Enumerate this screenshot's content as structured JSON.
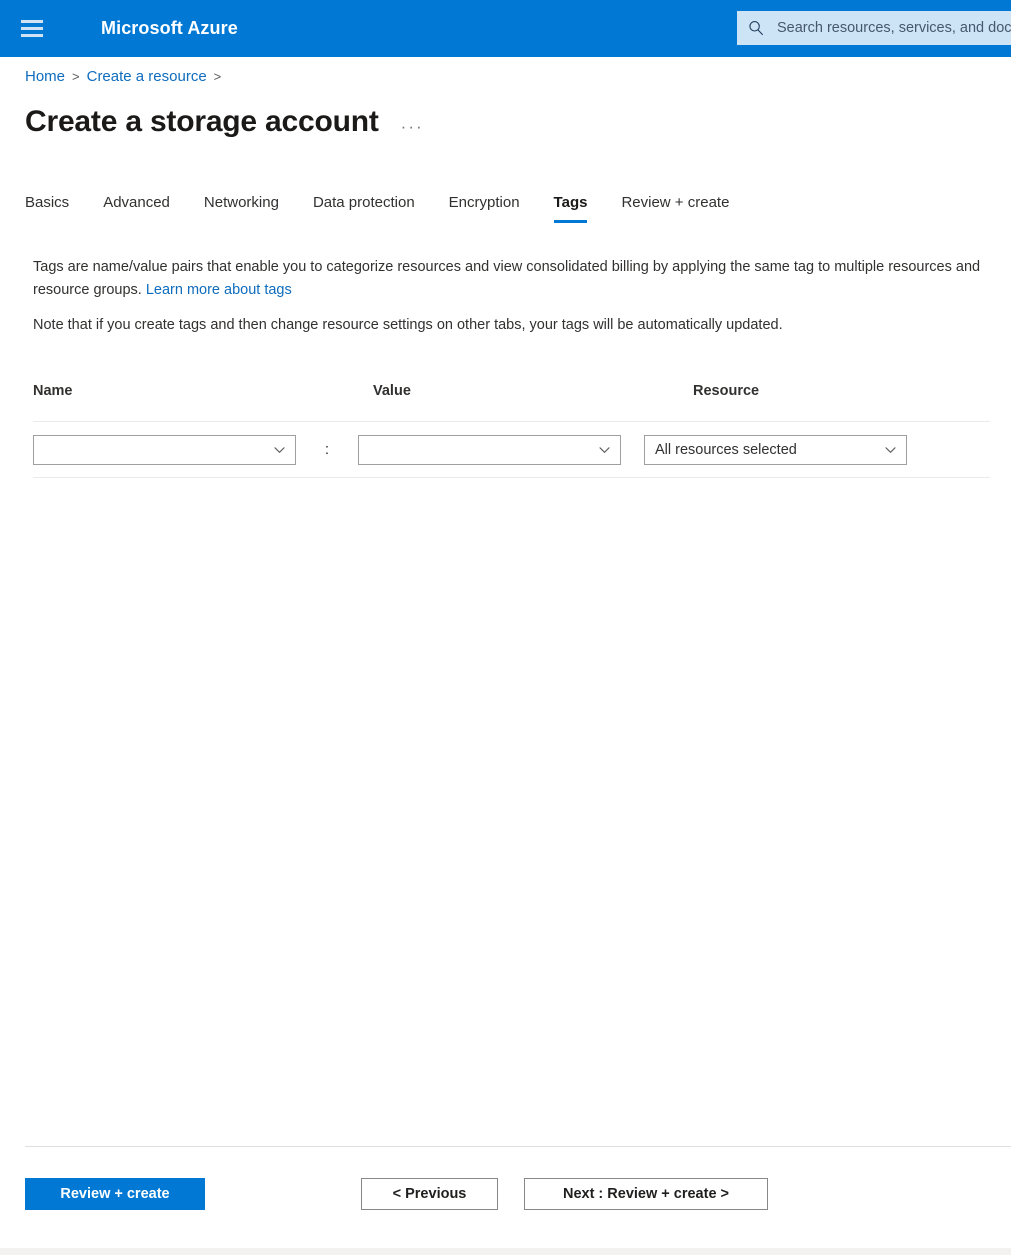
{
  "topbar": {
    "menu_icon": "hamburger-icon",
    "brand": "Microsoft Azure",
    "search_icon": "search-icon",
    "search_placeholder": "Search resources, services, and docs (G+/)",
    "search_value": "",
    "accent_color": "#0078d4",
    "search_bg": "#cde3f6"
  },
  "breadcrumb": {
    "items": [
      {
        "label": "Home",
        "separator": ">"
      },
      {
        "label": "Create a resource",
        "separator": ">"
      }
    ],
    "link_color": "#0f6cbd"
  },
  "page": {
    "title": "Create a storage account",
    "more_label": "···"
  },
  "tabs": {
    "items": [
      {
        "label": "Basics",
        "active": false
      },
      {
        "label": "Advanced",
        "active": false
      },
      {
        "label": "Networking",
        "active": false
      },
      {
        "label": "Data protection",
        "active": false
      },
      {
        "label": "Encryption",
        "active": false
      },
      {
        "label": "Tags",
        "active": true
      },
      {
        "label": "Review + create",
        "active": false
      }
    ],
    "active_underline_color": "#0078d4"
  },
  "description": {
    "line1_part1": "Tags are name/value pairs that enable you to categorize resources and view consolidated billing by applying the same tag to multiple resources and resource groups. ",
    "link_text": "Learn more about tags",
    "note": "Note that if you create tags and then change resource settings on other tabs, your tags will be automatically updated."
  },
  "tag_table": {
    "headers": {
      "name": "Name",
      "value": "Value",
      "resource": "Resource"
    },
    "separator": ":",
    "rows": [
      {
        "name_value": "",
        "value_value": "",
        "resource_value": "All resources selected",
        "chevron_icon": "chevron-down-icon"
      }
    ]
  },
  "footer": {
    "review_create": "Review + create",
    "previous": "< Previous",
    "next": "Next : Review + create >",
    "primary_color": "#0078d4"
  }
}
